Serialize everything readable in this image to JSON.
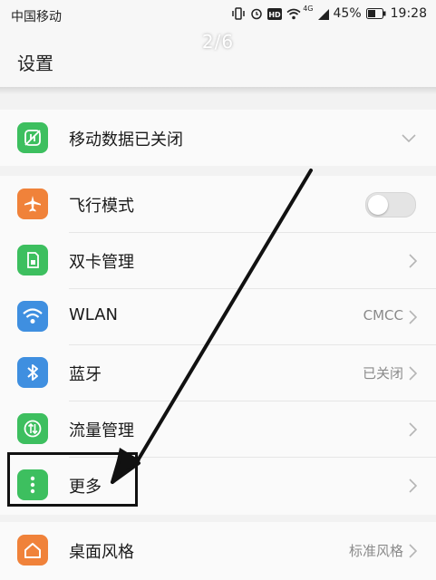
{
  "status_bar": {
    "carrier": "中国移动",
    "network": "4G",
    "battery": "45%",
    "time": "19:28"
  },
  "page_indicator": "2/6",
  "header": {
    "title": "设置"
  },
  "mobile_data": {
    "label": "移动数据已关闭",
    "icon": "mobile-data-off-icon",
    "icon_color": "#3dbf5f"
  },
  "settings": [
    {
      "label": "飞行模式",
      "icon": "airplane-icon",
      "icon_color": "#f0823a",
      "control": "toggle",
      "toggle_on": false
    },
    {
      "label": "双卡管理",
      "icon": "sim-card-icon",
      "icon_color": "#3dbf5f",
      "control": "chevron"
    },
    {
      "label": "WLAN",
      "icon": "wifi-icon",
      "icon_color": "#3f8fe0",
      "value": "CMCC",
      "control": "chevron"
    },
    {
      "label": "蓝牙",
      "icon": "bluetooth-icon",
      "icon_color": "#3f8fe0",
      "value": "已关闭",
      "control": "chevron"
    },
    {
      "label": "流量管理",
      "icon": "traffic-icon",
      "icon_color": "#3dbf5f",
      "control": "chevron"
    },
    {
      "label": "更多",
      "icon": "more-icon",
      "icon_color": "#3dbf5f",
      "control": "chevron"
    }
  ],
  "theme_row": {
    "label": "桌面风格",
    "icon": "home-icon",
    "icon_color": "#f0823a",
    "value": "标准风格"
  }
}
